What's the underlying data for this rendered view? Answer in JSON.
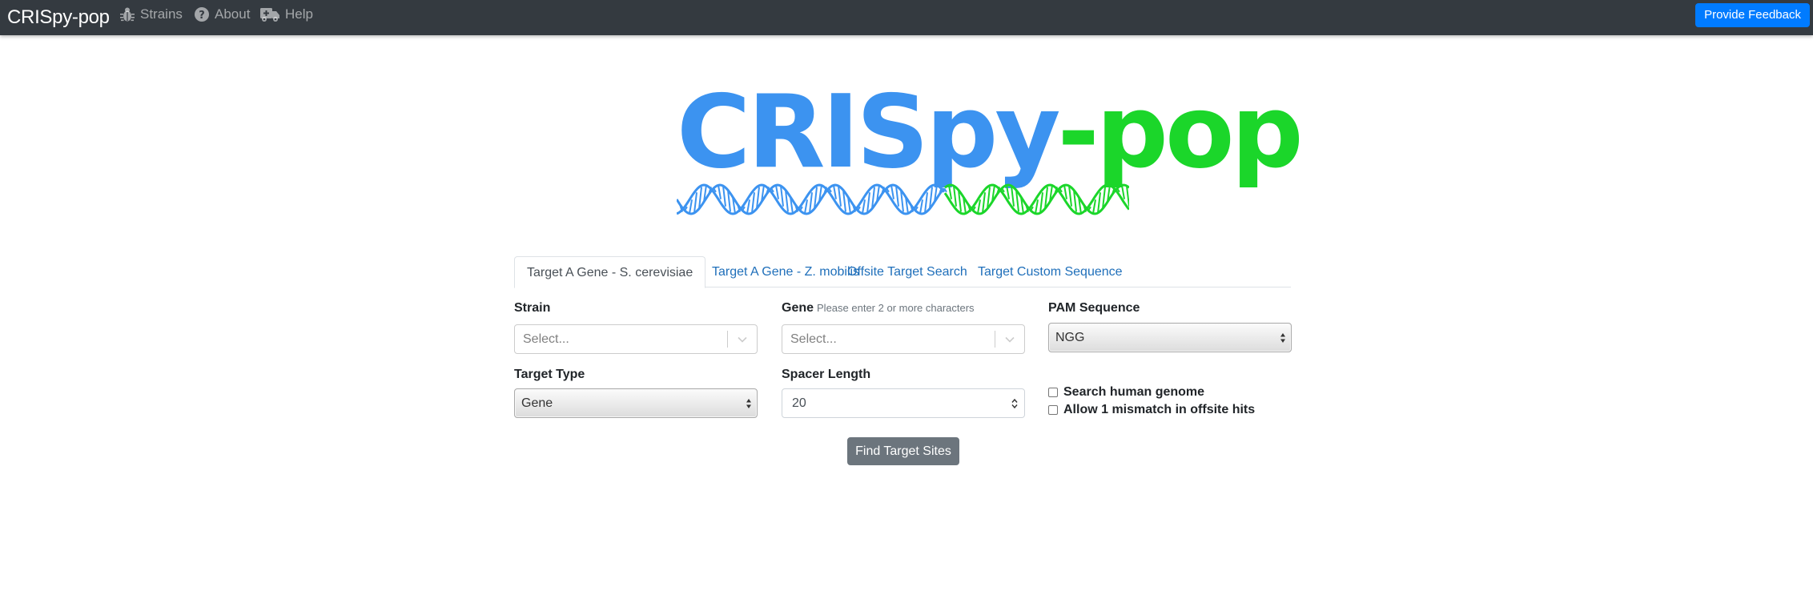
{
  "navbar": {
    "brand": "CRISpy-pop",
    "links": [
      {
        "label": "Strains",
        "icon": "bug-icon"
      },
      {
        "label": "About",
        "icon": "question-circle-icon"
      },
      {
        "label": "Help",
        "icon": "ambulance-icon"
      }
    ],
    "feedback_button": "Provide Feedback"
  },
  "logo": {
    "text_blue": "CRISpy",
    "text_dash": "-",
    "text_green": "pop",
    "colors": {
      "blue": "#3c93f0",
      "green": "#1bd62a"
    }
  },
  "tabs": [
    {
      "label": "Target A Gene - S. cerevisiae",
      "active": true
    },
    {
      "label": "Target A Gene - Z. mobilis",
      "active": false
    },
    {
      "label": "Offsite Target Search",
      "active": false
    },
    {
      "label": "Target Custom Sequence",
      "active": false
    }
  ],
  "form": {
    "strain": {
      "label": "Strain",
      "placeholder": "Select..."
    },
    "gene": {
      "label": "Gene",
      "hint": "Please enter 2 or more characters",
      "placeholder": "Select..."
    },
    "pam": {
      "label": "PAM Sequence",
      "value": "NGG"
    },
    "target_type": {
      "label": "Target Type",
      "value": "Gene"
    },
    "spacer_length": {
      "label": "Spacer Length",
      "value": "20"
    },
    "options": [
      {
        "label": "Search human genome",
        "checked": false
      },
      {
        "label": "Allow 1 mismatch in offsite hits",
        "checked": false
      }
    ],
    "submit": "Find Target Sites"
  },
  "colors": {
    "navbar": "#343a40",
    "primary": "#007bff",
    "secondary": "#6c757d",
    "tab_link": "#1f6fba"
  }
}
